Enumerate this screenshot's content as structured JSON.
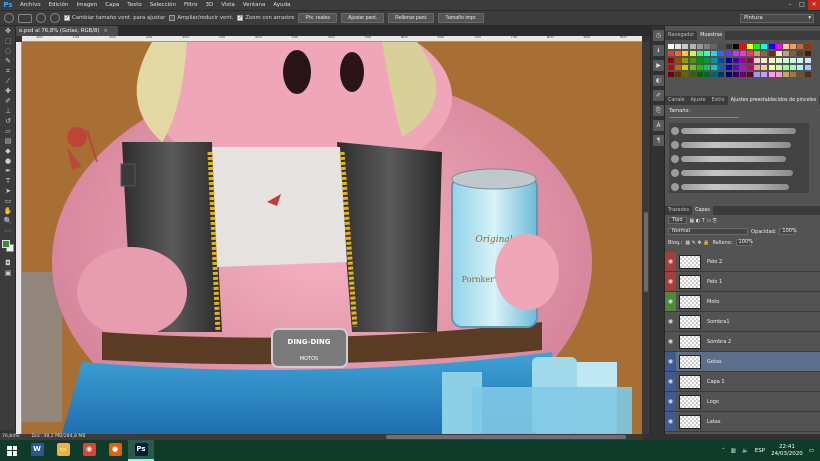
{
  "app": {
    "logo": "Ps"
  },
  "menu": [
    "Archivo",
    "Edición",
    "Imagen",
    "Capa",
    "Texto",
    "Selección",
    "Filtro",
    "3D",
    "Vista",
    "Ventana",
    "Ayuda"
  ],
  "window_controls": {
    "minimize": "–",
    "maximize": "□",
    "close": "✕"
  },
  "options_bar": {
    "resize_window_label": "Cambiar tamaño vent. para ajustar",
    "resize_window_checked": true,
    "zoom_all_label": "Ampliar/reducir vent.",
    "zoom_all_checked": false,
    "scrubby_label": "Zoom con arrastre",
    "scrubby_checked": true,
    "btn_actual": "Píx. reales",
    "btn_fit": "Ajustar pant.",
    "btn_fill": "Rellenar pant.",
    "btn_print": "Tamaño impr.",
    "workspace": "Pintura"
  },
  "document": {
    "tab_title": "o.psd al 76,8% (Gotas, RGB/8)",
    "close_glyph": "×",
    "zoom": "76,84%",
    "doc_info": "Doc: 48,2 MB/284,8 MB"
  },
  "ruler": {
    "top_ticks": [
      "100",
      "150",
      "200",
      "250",
      "300",
      "350",
      "400",
      "450",
      "500",
      "550",
      "600",
      "650",
      "700",
      "750",
      "800",
      "850",
      "900"
    ]
  },
  "canvas_text": {
    "belt_buckle_top": "DING-DING",
    "belt_buckle_bottom": "MOTOS",
    "can_brand_top": "Original",
    "can_brand_bottom": "Pornker's BEER"
  },
  "swatches_panel": {
    "tabs": [
      "Navegador",
      "Muestras"
    ],
    "active_tab": "Muestras",
    "colors": [
      "#ffffff",
      "#e6e6e6",
      "#cccccc",
      "#b3b3b3",
      "#999999",
      "#808080",
      "#666666",
      "#4d4d4d",
      "#333333",
      "#000000",
      "#ff0000",
      "#ffff00",
      "#00ff00",
      "#00ffff",
      "#0000ff",
      "#ff00ff",
      "#ffcc99",
      "#ff9966",
      "#cc6633",
      "#993300",
      "#ff3333",
      "#ff6633",
      "#ffcc33",
      "#ccff33",
      "#33ff66",
      "#33ffcc",
      "#33ccff",
      "#3366ff",
      "#6633ff",
      "#cc33ff",
      "#ff33cc",
      "#ff3366",
      "#cc9966",
      "#996633",
      "#663300",
      "#ffe0c0",
      "#c0a080",
      "#806040",
      "#604020",
      "#402000",
      "#990000",
      "#994c00",
      "#999900",
      "#4c9900",
      "#009900",
      "#00994c",
      "#009999",
      "#004c99",
      "#000099",
      "#4c0099",
      "#990099",
      "#99004c",
      "#ffcccc",
      "#ffe5cc",
      "#ffffcc",
      "#e5ffcc",
      "#ccffcc",
      "#ccffe5",
      "#ccffff",
      "#cce5ff",
      "#cc0000",
      "#cc6600",
      "#cccc00",
      "#66cc00",
      "#00cc00",
      "#00cc66",
      "#00cccc",
      "#0066cc",
      "#0000cc",
      "#6600cc",
      "#cc00cc",
      "#cc0066",
      "#ff9999",
      "#ffcc99",
      "#ffff99",
      "#ccff99",
      "#99ff99",
      "#99ffcc",
      "#99ffff",
      "#99ccff",
      "#660000",
      "#663300",
      "#666600",
      "#336600",
      "#006600",
      "#006633",
      "#006666",
      "#003366",
      "#000066",
      "#330066",
      "#660066",
      "#660033",
      "#9999ff",
      "#cc99ff",
      "#ff99ff",
      "#ff99cc",
      "#c8a070",
      "#a07848",
      "#785030",
      "#503018"
    ]
  },
  "brush_panel": {
    "tabs": [
      "Canale",
      "Ajuste",
      "Estilo",
      "Ajustes preestablecidos de pinceles"
    ],
    "active_tab": "Ajustes preestablecidos de pinceles",
    "size_label": "Tamaño:"
  },
  "layers_panel": {
    "tabs": [
      "Trazados",
      "Capas"
    ],
    "active_tab": "Capas",
    "filter_label": "Tipo",
    "blend_mode": "Normal",
    "opacity_label": "Opacidad:",
    "opacity_value": "100%",
    "lock_label": "Bloq.:",
    "fill_label": "Relleno:",
    "fill_value": "100%",
    "layers": [
      {
        "name": "Pelo 2",
        "color": "#a83c3c",
        "visible": true,
        "selected": false
      },
      {
        "name": "Pelo 1",
        "color": "#a83c3c",
        "visible": true,
        "selected": false
      },
      {
        "name": "Moto",
        "color": "#4c8a36",
        "visible": true,
        "selected": false
      },
      {
        "name": "Sombra1",
        "color": "#535353",
        "visible": true,
        "selected": false
      },
      {
        "name": "Sombra 2",
        "color": "#535353",
        "visible": true,
        "selected": false
      },
      {
        "name": "Gotas",
        "color": "#3d5a91",
        "visible": true,
        "selected": true
      },
      {
        "name": "Capa 1",
        "color": "#3d5a91",
        "visible": true,
        "selected": false
      },
      {
        "name": "Logo",
        "color": "#3d5a91",
        "visible": true,
        "selected": false
      },
      {
        "name": "Latas",
        "color": "#3d5a91",
        "visible": true,
        "selected": false
      }
    ]
  },
  "taskbar": {
    "apps": [
      {
        "name": "Word",
        "glyph": "W",
        "color": "#2b579a",
        "active": false
      },
      {
        "name": "Explorer",
        "glyph": "▭",
        "color": "#e8b43a",
        "active": false
      },
      {
        "name": "Chrome",
        "glyph": "◉",
        "color": "#db4437",
        "active": false
      },
      {
        "name": "Firefox",
        "glyph": "●",
        "color": "#e66000",
        "active": false
      },
      {
        "name": "Photoshop",
        "glyph": "Ps",
        "color": "#001e36",
        "active": true
      }
    ],
    "language": "ESP",
    "time": "22:41",
    "date": "24/03/2020"
  }
}
